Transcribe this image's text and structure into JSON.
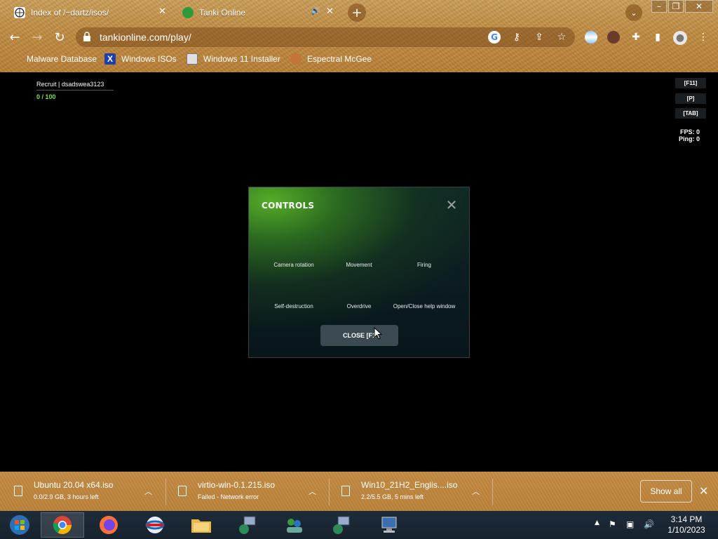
{
  "browser": {
    "tabs": [
      {
        "title": "Index of /~dartz/isos/",
        "active": false
      },
      {
        "title": "Tanki Online",
        "active": true
      }
    ],
    "url": "tankionline.com/play/",
    "bookmarks": [
      {
        "label": "Malware Database"
      },
      {
        "label": "Windows ISOs"
      },
      {
        "label": "Windows 11 Installer"
      },
      {
        "label": "Espectral McGee"
      }
    ]
  },
  "game": {
    "player_name": "Recruit | dsadswea3123",
    "xp": "0 / 100",
    "hotkeys": [
      "[F11]",
      "[P]",
      "[TAB]"
    ],
    "fps": "FPS: 0",
    "ping": "Ping: 0",
    "dialog": {
      "title": "CONTROLS",
      "controls": [
        {
          "label": "Camera rotation"
        },
        {
          "label": "Movement"
        },
        {
          "label": "Firing"
        },
        {
          "label": "Self-destruction"
        },
        {
          "label": "Overdrive"
        },
        {
          "label": "Open/Close help window"
        }
      ],
      "close_button": "CLOSE [F1"
    }
  },
  "downloads": {
    "items": [
      {
        "name": "Ubuntu 20.04 x64.iso",
        "status": "0.0/2.9 GB, 3 hours left"
      },
      {
        "name": "virtio-win-0.1.215.iso",
        "status": "Failed - Network error"
      },
      {
        "name": "Win10_21H2_Englis....iso",
        "status": "2.2/5.5 GB, 5 mins left"
      }
    ],
    "show_all": "Show all"
  },
  "taskbar": {
    "time": "3:14 PM",
    "date": "1/10/2023"
  }
}
